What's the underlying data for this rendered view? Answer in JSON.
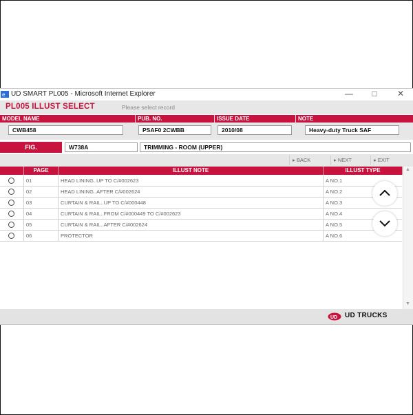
{
  "window": {
    "title": "UD SMART PL005 - Microsoft Internet Explorer",
    "controls": {
      "minimize": "—",
      "maximize": "□",
      "close": "✕"
    }
  },
  "header": {
    "title": "PL005 ILLUST SELECT",
    "subtitle": "Please select record"
  },
  "fields": {
    "model_name": {
      "label": "MODEL NAME",
      "value": "CWB458"
    },
    "pub_no": {
      "label": "PUB. NO.",
      "value": "PSAF0 2CWBB"
    },
    "issue_date": {
      "label": "ISSUE DATE",
      "value": "2010/08"
    },
    "note": {
      "label": "NOTE",
      "value": "Heavy-duty Truck SAF"
    }
  },
  "fig": {
    "label": "FIG.",
    "code": "W738A",
    "description": "TRIMMING - ROOM (UPPER)"
  },
  "nav": {
    "back": "BACK",
    "next": "NEXT",
    "exit": "EXIT",
    "arrow": "▸"
  },
  "table": {
    "headers": {
      "page": "PAGE",
      "note": "ILLUST NOTE",
      "type": "ILLUST TYPE"
    },
    "rows": [
      {
        "page": "01",
        "note": "HEAD LINING..UP TO C/#002623",
        "type": "A NO.1"
      },
      {
        "page": "02",
        "note": "HEAD LINING..AFTER C/#002624",
        "type": "A NO.2"
      },
      {
        "page": "03",
        "note": "CURTAIN & RAIL..UP TO C/#000448",
        "type": "A NO.3"
      },
      {
        "page": "04",
        "note": "CURTAIN & RAIL..FROM C/#000449 TO C/#002623",
        "type": "A NO.4"
      },
      {
        "page": "05",
        "note": "CURTAIN & RAIL..AFTER C/#002624",
        "type": "A NO.5"
      },
      {
        "page": "06",
        "note": "PROTECTOR",
        "type": "A NO.6"
      }
    ]
  },
  "footer": {
    "brand": "UD TRUCKS",
    "logo_text": "UD"
  },
  "colors": {
    "accent": "#c8133f",
    "band": "#e7e7e7"
  },
  "icons": [
    "ie-icon",
    "chevron-up-icon",
    "chevron-down-icon",
    "radio-icon",
    "ud-logo-icon"
  ]
}
